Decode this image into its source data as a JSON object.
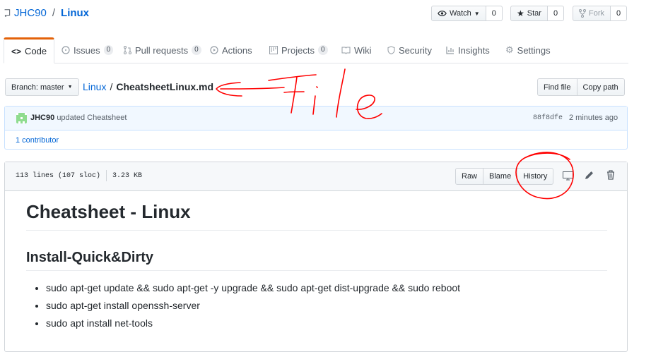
{
  "repo": {
    "owner": "JHC90",
    "separator": "/",
    "name": "Linux"
  },
  "actions": {
    "watch": {
      "label": "Watch",
      "count": "0"
    },
    "star": {
      "label": "Star",
      "count": "0"
    },
    "fork": {
      "label": "Fork",
      "count": "0"
    }
  },
  "tabs": [
    {
      "label": "Code",
      "icon": "code-icon",
      "active": true
    },
    {
      "label": "Issues",
      "badge": "0",
      "icon": "issue-icon"
    },
    {
      "label": "Pull requests",
      "badge": "0",
      "icon": "pull-request-icon"
    },
    {
      "label": "Actions",
      "icon": "play-icon"
    },
    {
      "label": "Projects",
      "badge": "0",
      "icon": "project-icon"
    },
    {
      "label": "Wiki",
      "icon": "book-icon"
    },
    {
      "label": "Security",
      "icon": "shield-icon"
    },
    {
      "label": "Insights",
      "icon": "graph-icon"
    },
    {
      "label": "Settings",
      "icon": "gear-icon"
    }
  ],
  "branch": {
    "label": "Branch: master"
  },
  "breadcrumb": {
    "repo": "Linux",
    "separator": "/",
    "file": "CheatsheetLinux.md"
  },
  "file_buttons": {
    "find": "Find file",
    "copy": "Copy path"
  },
  "commit": {
    "author": "JHC90",
    "message": "updated Cheatsheet",
    "sha": "88f8dfe",
    "time": "2 minutes ago",
    "contributors": "1 contributor"
  },
  "fileinfo": {
    "lines": "113 lines (107 sloc)",
    "size": "3.23 KB"
  },
  "view_buttons": {
    "raw": "Raw",
    "blame": "Blame",
    "history": "History"
  },
  "markdown": {
    "h1": "Cheatsheet - Linux",
    "h2": "Install-Quick&Dirty",
    "items": [
      "sudo apt-get update && sudo apt-get -y upgrade && sudo apt-get dist-upgrade && sudo reboot",
      "sudo apt-get install openssh-server",
      "sudo apt install net-tools"
    ]
  },
  "annotation": {
    "text": "File",
    "color": "#ff0000"
  }
}
